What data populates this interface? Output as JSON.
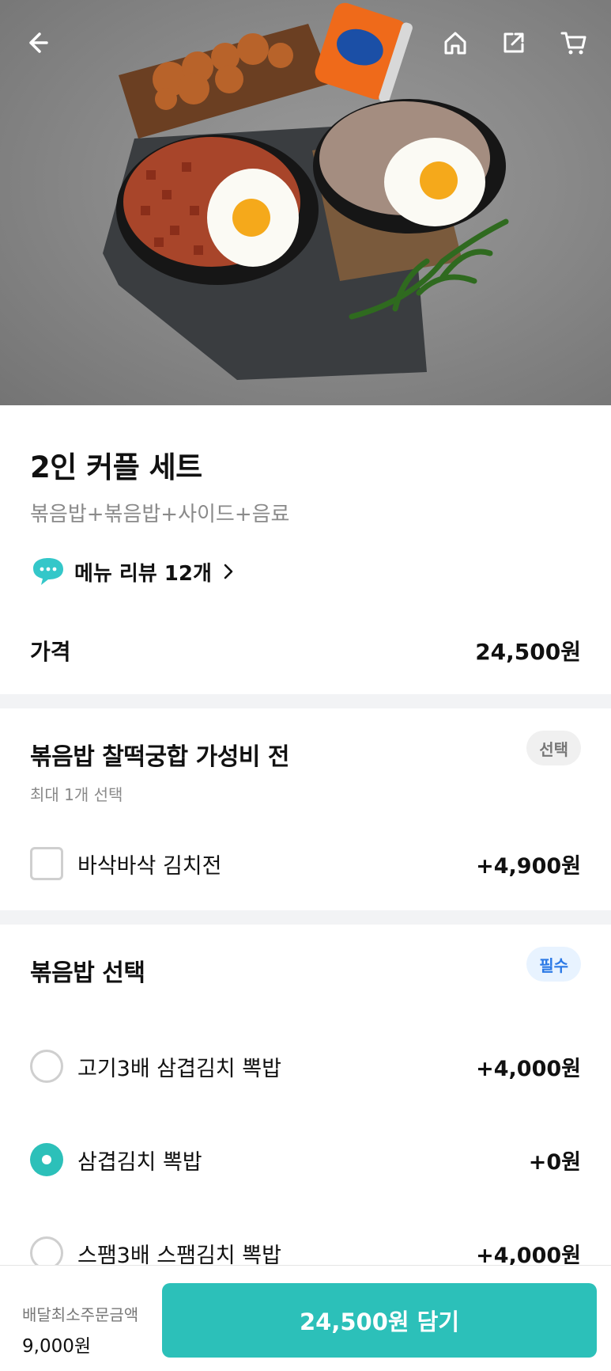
{
  "header": {
    "icons": [
      "back-arrow-icon",
      "home-icon",
      "share-icon",
      "cart-icon"
    ]
  },
  "product": {
    "title": "2인 커플 세트",
    "subtitle": "볶음밥+볶음밥+사이드+음료",
    "review_label": "메뉴 리뷰 12개",
    "price_label": "가격",
    "price_value": "24,500원"
  },
  "option_groups": [
    {
      "title": "볶음밥 찰떡궁합 가성비 전",
      "subtitle": "최대 1개 선택",
      "badge": "선택",
      "options": [
        {
          "name": "바삭바삭 김치전",
          "price": "+4,900원",
          "checked": false
        }
      ]
    },
    {
      "title": "볶음밥 선택",
      "badge": "필수",
      "options": [
        {
          "name": "고기3배 삼겹김치 뽁밥",
          "price": "+4,000원",
          "selected": false
        },
        {
          "name": "삼겹김치 뽁밥",
          "price": "+0원",
          "selected": true
        },
        {
          "name": "스팸3배 스팸김치 뽁밥",
          "price": "+4,000원",
          "selected": false
        }
      ]
    }
  ],
  "bottom_bar": {
    "min_order_label": "배달최소주문금액",
    "min_order_value": "9,000원",
    "add_button_label": "24,500원 담기"
  },
  "colors": {
    "accent": "#2cc0b9",
    "required_badge": "#2b79e6",
    "page_divider": "#f2f3f5"
  }
}
